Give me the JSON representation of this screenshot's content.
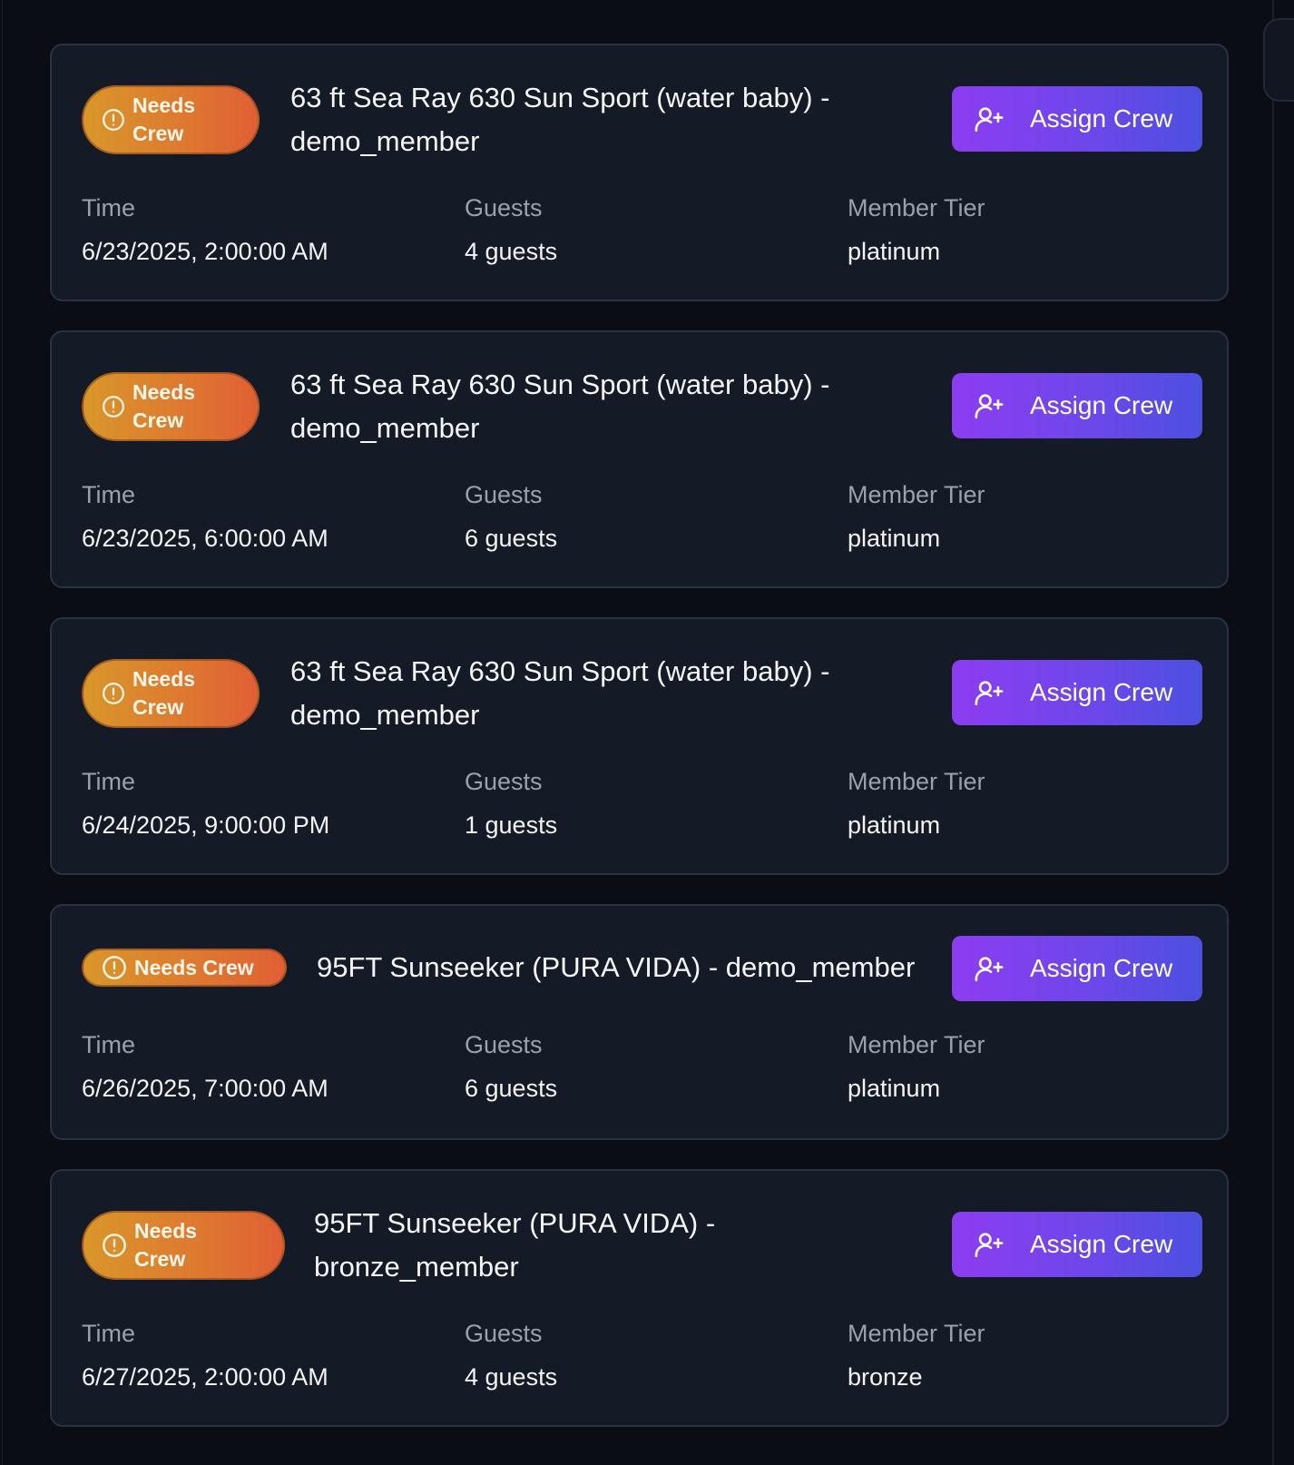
{
  "colors": {
    "badge_gradient_start": "#d9962a",
    "badge_gradient_end": "#e05f34",
    "button_gradient_start": "#8d3df0",
    "button_gradient_end": "#4c50e0",
    "card_background": "#151b26",
    "page_background": "#0a0d14"
  },
  "labels": {
    "time": "Time",
    "guests": "Guests",
    "member_tier": "Member Tier"
  },
  "bookings": [
    {
      "status": "Needs Crew",
      "title": "63 ft Sea Ray 630 Sun Sport (water baby) - demo_member",
      "button": "Assign Crew",
      "time": "6/23/2025, 2:00:00 AM",
      "guests": "4 guests",
      "tier": "platinum"
    },
    {
      "status": "Needs Crew",
      "title": "63 ft Sea Ray 630 Sun Sport (water baby) - demo_member",
      "button": "Assign Crew",
      "time": "6/23/2025, 6:00:00 AM",
      "guests": "6 guests",
      "tier": "platinum"
    },
    {
      "status": "Needs Crew",
      "title": "63 ft Sea Ray 630 Sun Sport (water baby) - demo_member",
      "button": "Assign Crew",
      "time": "6/24/2025, 9:00:00 PM",
      "guests": "1 guests",
      "tier": "platinum"
    },
    {
      "status": "Needs Crew",
      "title": "95FT Sunseeker (PURA VIDA) - demo_member",
      "button": "Assign Crew",
      "time": "6/26/2025, 7:00:00 AM",
      "guests": "6 guests",
      "tier": "platinum"
    },
    {
      "status": "Needs Crew",
      "title": "95FT Sunseeker (PURA VIDA) - bronze_member",
      "button": "Assign Crew",
      "time": "6/27/2025, 2:00:00 AM",
      "guests": "4 guests",
      "tier": "bronze"
    }
  ]
}
